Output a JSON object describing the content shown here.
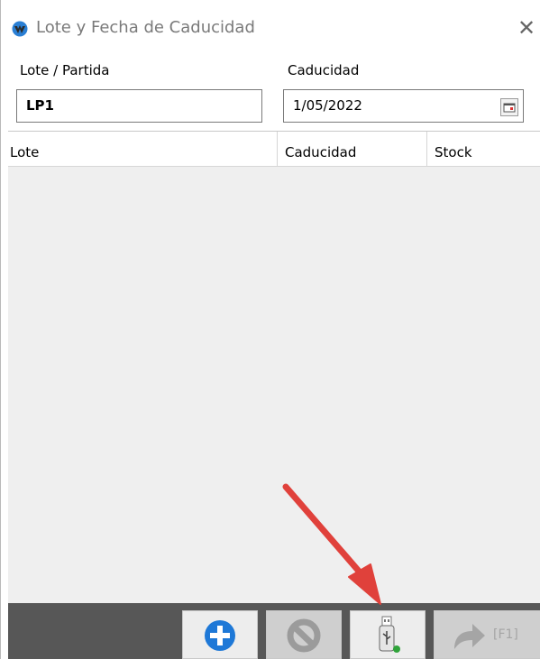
{
  "window": {
    "title": "Lote y Fecha de Caducidad",
    "close_glyph": "✕"
  },
  "form": {
    "lote_label": "Lote / Partida",
    "lote_value": "LP1",
    "caducidad_label": "Caducidad",
    "caducidad_value": "1/05/2022"
  },
  "grid": {
    "columns": [
      "Lote",
      "Caducidad",
      "Stock"
    ],
    "rows": []
  },
  "toolbar": {
    "f1_label": "[F1]"
  },
  "icons": {
    "app": "app-logo-icon",
    "close": "close-icon",
    "calendar": "calendar-icon",
    "add": "plus-circle-icon",
    "cancel": "cancel-icon",
    "usb": "usb-drive-icon",
    "f1": "forward-arrow-icon"
  },
  "colors": {
    "toolbar_bg": "#575757",
    "add_blue": "#1e78d7",
    "annotation_arrow": "#e0413b"
  }
}
